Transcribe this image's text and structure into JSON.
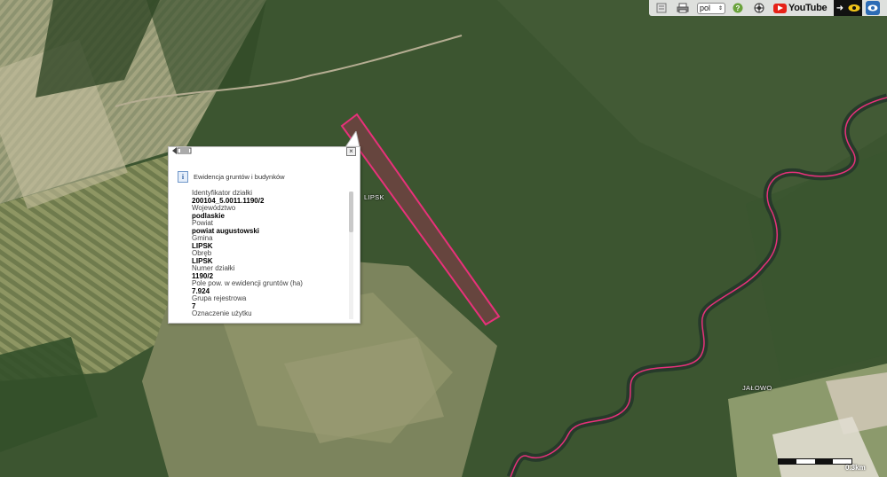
{
  "toolbar": {
    "language": "pol",
    "youtube_label": "YouTube",
    "icons": [
      "document-icon",
      "print-icon",
      "help-icon",
      "ball-icon",
      "arrow-icon",
      "eye-icon"
    ]
  },
  "popup": {
    "title": "Ewidencja gruntów i budynków",
    "fields": [
      {
        "label": "Identyfikator działki",
        "value": "200104_5.0011.1190/2"
      },
      {
        "label": "Województwo",
        "value": "podlaskie"
      },
      {
        "label": "Powiat",
        "value": "powiat augustowski"
      },
      {
        "label": "Gmina",
        "value": "LIPSK"
      },
      {
        "label": "Obręb",
        "value": "LIPSK"
      },
      {
        "label": "Numer działki",
        "value": "1190/2"
      },
      {
        "label": "Pole pow. w ewidencji gruntów (ha)",
        "value": "7.924"
      },
      {
        "label": "Grupa rejestrowa",
        "value": "7"
      },
      {
        "label": "Oznaczenie użytku",
        "value": ""
      }
    ]
  },
  "map": {
    "labels": {
      "lipsk": "LIPSK",
      "jalowo": "JAŁOWO"
    },
    "scale_label": "0.3km",
    "colors": {
      "parcel": "#e8317a",
      "river": "#e8317a",
      "forest": "#3a5a2c",
      "field": "#a8a27a"
    }
  }
}
